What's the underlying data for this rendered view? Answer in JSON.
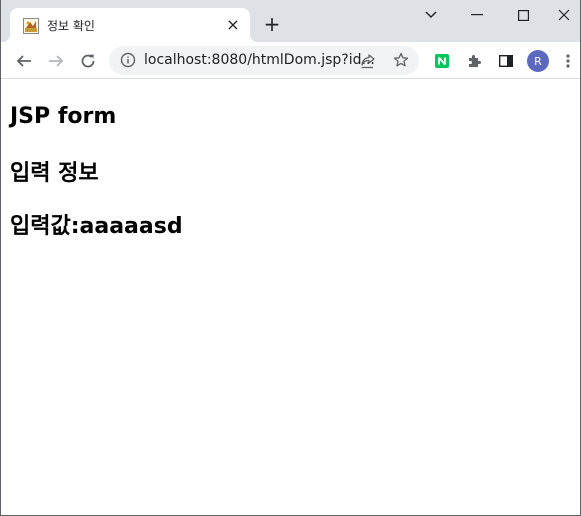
{
  "tab": {
    "title": "정보 확인",
    "close_glyph": "×"
  },
  "window": {
    "new_tab_glyph": "+"
  },
  "toolbar": {
    "url": "localhost:8080/htmlDom.jsp?id...",
    "avatar_initial": "R"
  },
  "page": {
    "heading1": "JSP form",
    "heading2": "입력 정보",
    "heading3": "입력값:aaaaasd"
  },
  "colors": {
    "tab_strip": "#dee1e6",
    "omnibox": "#f1f3f4",
    "avatar": "#5b6abf",
    "extension_n": "#03c75a"
  }
}
